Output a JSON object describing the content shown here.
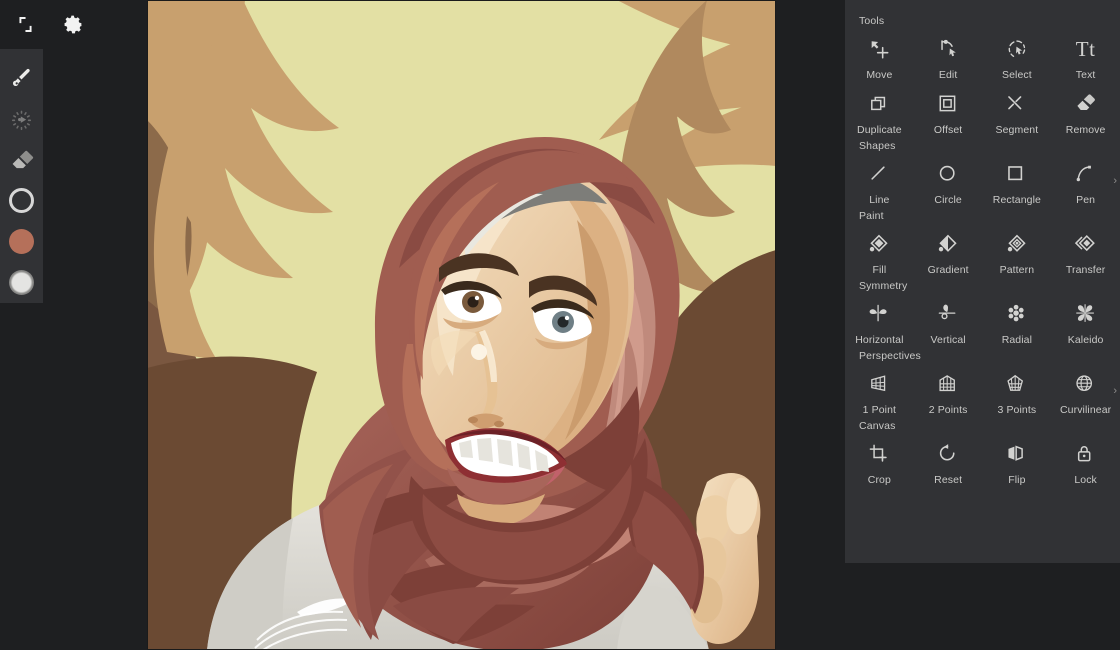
{
  "app": {
    "canvas_bg": "#0c0c0c",
    "shell_bg": "#1e1f21",
    "panel_bg": "#313235",
    "rail_bg": "#313235",
    "label_color": "#c9c9c7"
  },
  "left_rail": {
    "top_buttons": [
      {
        "name": "collapse-icon",
        "label": "Collapse"
      },
      {
        "name": "gear-icon",
        "label": "Settings"
      }
    ],
    "tools": [
      {
        "name": "brush-icon",
        "label": "Brush",
        "active": true
      },
      {
        "name": "smudge-icon",
        "label": "Smudge",
        "active": false
      },
      {
        "name": "eraser-icon",
        "label": "Eraser",
        "active": false
      },
      {
        "name": "brush-size-icon",
        "label": "Brush Size",
        "active": false
      },
      {
        "name": "color-swatch",
        "label": "Color",
        "color": "#b5705a"
      },
      {
        "name": "secondary-swatch",
        "label": "Secondary Color",
        "color": "#e4e4e2"
      }
    ]
  },
  "tool_panel": {
    "sections": [
      {
        "label": "Tools",
        "has_chevron": false,
        "items": [
          {
            "label": "Move",
            "icon": "move-icon"
          },
          {
            "label": "Edit",
            "icon": "edit-node-icon"
          },
          {
            "label": "Select",
            "icon": "select-lasso-icon"
          },
          {
            "label": "Text",
            "icon": "text-icon"
          }
        ]
      },
      {
        "label": "",
        "has_chevron": false,
        "items": [
          {
            "label": "Duplicate",
            "icon": "duplicate-icon"
          },
          {
            "label": "Offset",
            "icon": "offset-icon"
          },
          {
            "label": "Segment",
            "icon": "segment-icon"
          },
          {
            "label": "Remove",
            "icon": "remove-eraser-icon"
          }
        ]
      },
      {
        "label": "Shapes",
        "has_chevron": true,
        "items": [
          {
            "label": "Line",
            "icon": "line-icon"
          },
          {
            "label": "Circle",
            "icon": "circle-icon"
          },
          {
            "label": "Rectangle",
            "icon": "rectangle-icon"
          },
          {
            "label": "Pen",
            "icon": "pen-curve-icon"
          }
        ]
      },
      {
        "label": "Paint",
        "has_chevron": false,
        "items": [
          {
            "label": "Fill",
            "icon": "fill-icon"
          },
          {
            "label": "Gradient",
            "icon": "gradient-icon"
          },
          {
            "label": "Pattern",
            "icon": "pattern-icon"
          },
          {
            "label": "Transfer",
            "icon": "transfer-icon"
          }
        ]
      },
      {
        "label": "Symmetry",
        "has_chevron": false,
        "items": [
          {
            "label": "Horizontal",
            "icon": "symmetry-horizontal-icon"
          },
          {
            "label": "Vertical",
            "icon": "symmetry-vertical-icon"
          },
          {
            "label": "Radial",
            "icon": "symmetry-radial-icon"
          },
          {
            "label": "Kaleido",
            "icon": "symmetry-kaleido-icon"
          }
        ]
      },
      {
        "label": "Perspectives",
        "has_chevron": true,
        "items": [
          {
            "label": "1 Point",
            "icon": "perspective-1point-icon"
          },
          {
            "label": "2 Points",
            "icon": "perspective-2points-icon"
          },
          {
            "label": "3 Points",
            "icon": "perspective-3points-icon"
          },
          {
            "label": "Curvilinear",
            "icon": "perspective-curvilinear-icon"
          }
        ]
      },
      {
        "label": "Canvas",
        "has_chevron": false,
        "items": [
          {
            "label": "Crop",
            "icon": "crop-icon"
          },
          {
            "label": "Reset",
            "icon": "reset-rotate-icon"
          },
          {
            "label": "Flip",
            "icon": "flip-icon"
          },
          {
            "label": "Lock",
            "icon": "lock-icon"
          }
        ]
      }
    ]
  },
  "artwork": {
    "title": "Hijab portrait vector illustration",
    "palette": {
      "background_cream": "#e3e0a4",
      "background_tan": "#c8a06e",
      "background_brown": "#8c6a4a",
      "background_dark_brown": "#6b4a33",
      "hijab_mid": "#a05d50",
      "hijab_dark": "#7d4038",
      "hijab_light": "#c98f7f",
      "skin_light": "#f3ddbe",
      "skin_mid": "#e3bf94",
      "skin_shadow": "#c79a6d",
      "shirt": "#dedcd6"
    }
  }
}
